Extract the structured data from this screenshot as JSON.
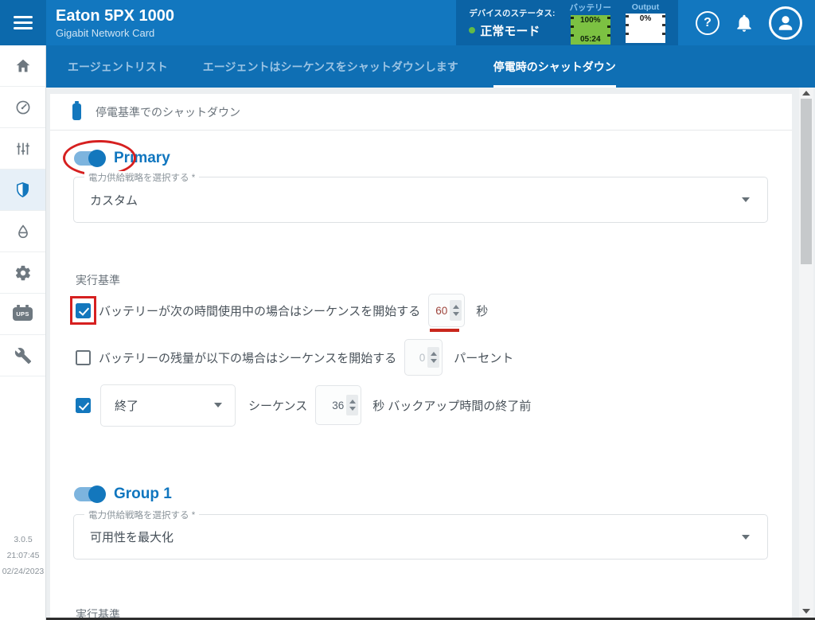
{
  "header": {
    "title": "Eaton 5PX 1000",
    "subtitle": "Gigabit Network Card",
    "device_status_label": "デバイスのステータス:",
    "device_status_value": "正常モード",
    "battery_label": "バッテリー",
    "battery_percent": "100%",
    "battery_time": "05:24",
    "output_label": "Output",
    "output_percent": "0%",
    "help_glyph": "?"
  },
  "tabs": [
    {
      "label": "エージェントリスト",
      "active": false
    },
    {
      "label": "エージェントはシーケンスをシャットダウンします",
      "active": false
    },
    {
      "label": "停電時のシャットダウン",
      "active": true
    }
  ],
  "sidebar": {
    "ups_badge": "UPS",
    "version": "3.0.5",
    "time": "21:07:45",
    "date": "02/24/2023"
  },
  "main": {
    "section_title": "停電基準でのシャットダウン",
    "criteria_heading": "実行基準",
    "primary": {
      "name": "Primary",
      "toggle_on": true,
      "strategy_label": "電力供給戦略を選択する *",
      "strategy_value": "カスタム"
    },
    "criteria_rows": {
      "row1": {
        "checked": true,
        "label": "バッテリーが次の時間使用中の場合はシーケンスを開始する",
        "value": "60",
        "unit": "秒"
      },
      "row2": {
        "checked": false,
        "label": "バッテリーの残量が以下の場合はシーケンスを開始する",
        "value": "0",
        "unit": "パーセント"
      },
      "row3": {
        "checked": true,
        "select_value": "終了",
        "mid_label": "シーケンス",
        "value": "36",
        "unit": "秒 バックアップ時間の終了前"
      }
    },
    "group1": {
      "name": "Group 1",
      "toggle_on": true,
      "strategy_label": "電力供給戦略を選択する *",
      "strategy_value": "可用性を最大化"
    }
  },
  "colors": {
    "accent": "#1377bd",
    "annotation_red": "#d62020",
    "battery_green": "#7cc142",
    "status_green": "#62bb46"
  }
}
